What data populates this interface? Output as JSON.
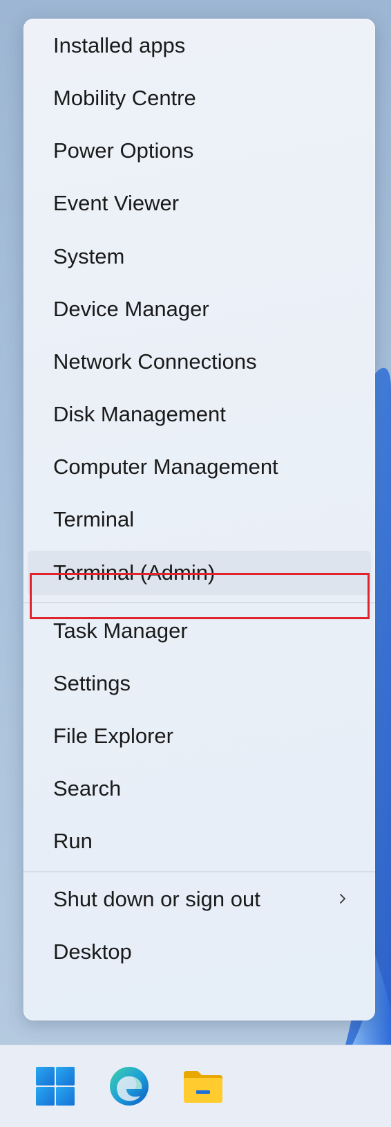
{
  "menu": {
    "items": [
      {
        "label": "Installed apps"
      },
      {
        "label": "Mobility Centre"
      },
      {
        "label": "Power Options"
      },
      {
        "label": "Event Viewer"
      },
      {
        "label": "System"
      },
      {
        "label": "Device Manager"
      },
      {
        "label": "Network Connections"
      },
      {
        "label": "Disk Management"
      },
      {
        "label": "Computer Management"
      },
      {
        "label": "Terminal"
      },
      {
        "label": "Terminal (Admin)"
      },
      {
        "label": "Task Manager"
      },
      {
        "label": "Settings"
      },
      {
        "label": "File Explorer"
      },
      {
        "label": "Search"
      },
      {
        "label": "Run"
      },
      {
        "label": "Shut down or sign out"
      },
      {
        "label": "Desktop"
      }
    ],
    "selected_item": "Terminal (Admin)",
    "submenu_icon": "chevron-right-icon"
  },
  "taskbar": {
    "icons": [
      "windows-start-icon",
      "edge-browser-icon",
      "file-explorer-icon"
    ]
  },
  "colors": {
    "highlight_border": "#e0232d",
    "menu_background": "#eef2f8",
    "selected_background": "#dde4ed",
    "text": "#1a1a1a"
  }
}
